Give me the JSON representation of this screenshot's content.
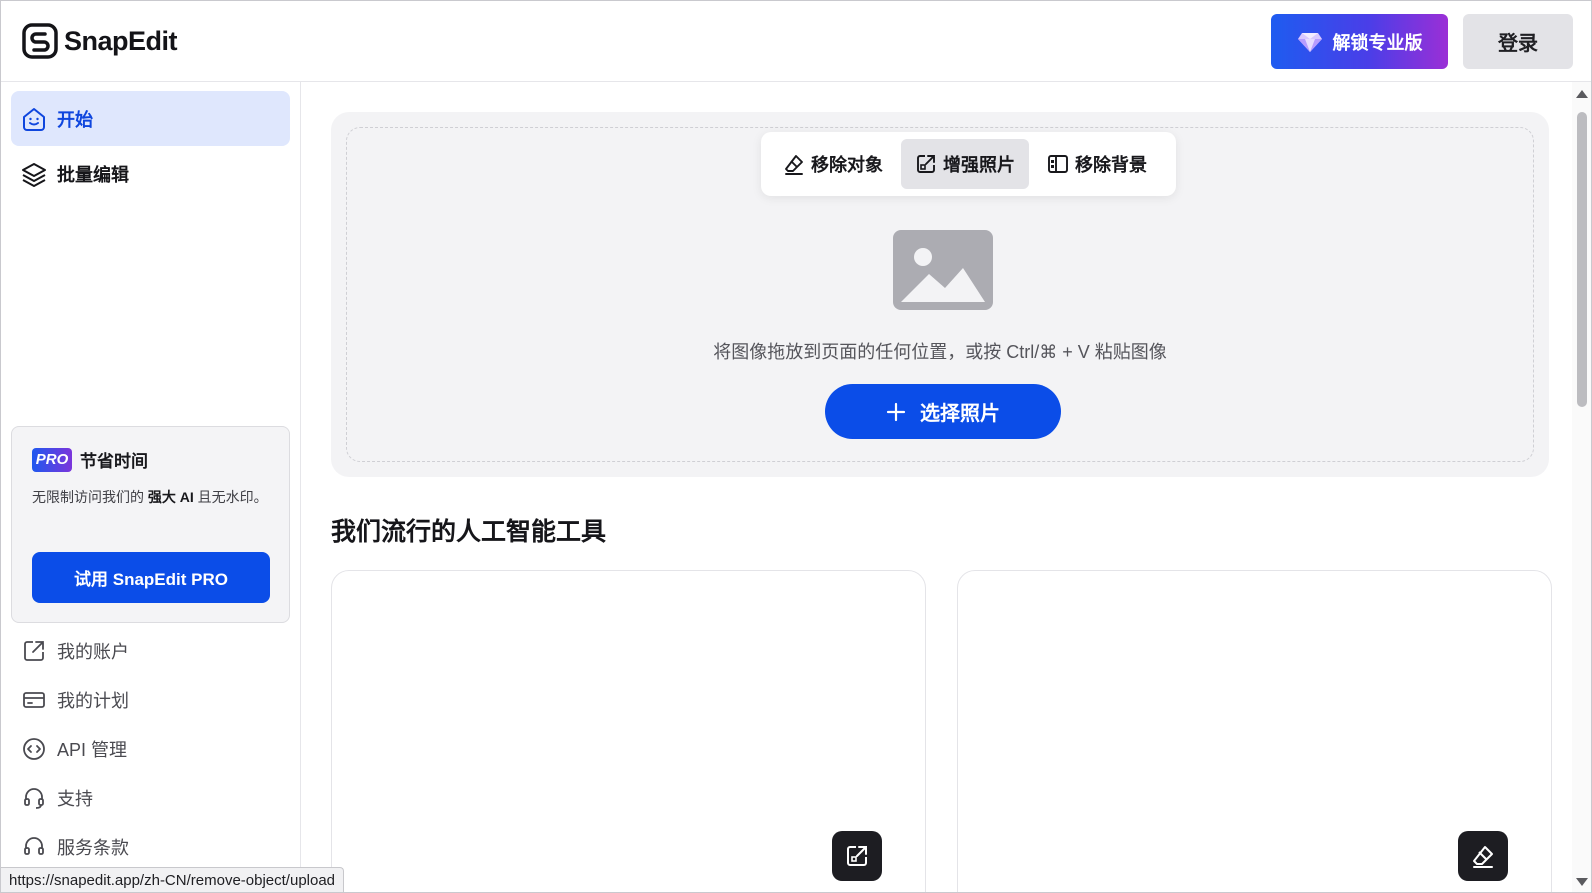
{
  "header": {
    "brand": "SnapEdit",
    "pro_button": "解锁专业版",
    "login_button": "登录"
  },
  "sidebar": {
    "nav": [
      {
        "label": "开始",
        "icon": "smile-home-icon",
        "active": true
      },
      {
        "label": "批量编辑",
        "icon": "layers-icon",
        "active": false
      }
    ],
    "promo": {
      "badge": "PRO",
      "title": "节省时间",
      "desc_prefix": "无限制访问我们的 ",
      "desc_bold": "强大 AI",
      "desc_suffix": " 且无水印。",
      "button": "试用 SnapEdit PRO"
    },
    "links": [
      {
        "label": "我的账户",
        "icon": "external-square-icon"
      },
      {
        "label": "我的计划",
        "icon": "credit-card-icon"
      },
      {
        "label": "API 管理",
        "icon": "code-circle-icon"
      },
      {
        "label": "支持",
        "icon": "headset-icon"
      },
      {
        "label": "服务条款",
        "icon": "headset-icon"
      }
    ]
  },
  "main": {
    "tabs": [
      {
        "label": "移除对象",
        "icon": "eraser-icon",
        "active": false
      },
      {
        "label": "增强照片",
        "icon": "enhance-icon",
        "active": true
      },
      {
        "label": "移除背景",
        "icon": "remove-bg-icon",
        "active": false
      }
    ],
    "drop_hint": "将图像拖放到页面的任何位置，或按 Ctrl/⌘ + V 粘贴图像",
    "choose_button": "选择照片",
    "section_title": "我们流行的人工智能工具"
  },
  "status_bar": {
    "url": "https://snapedit.app/zh-CN/remove-object/upload"
  },
  "colors": {
    "primary": "#0b4de8",
    "active_nav_bg": "#dfe7fd",
    "panel_bg": "#f3f3f5"
  }
}
